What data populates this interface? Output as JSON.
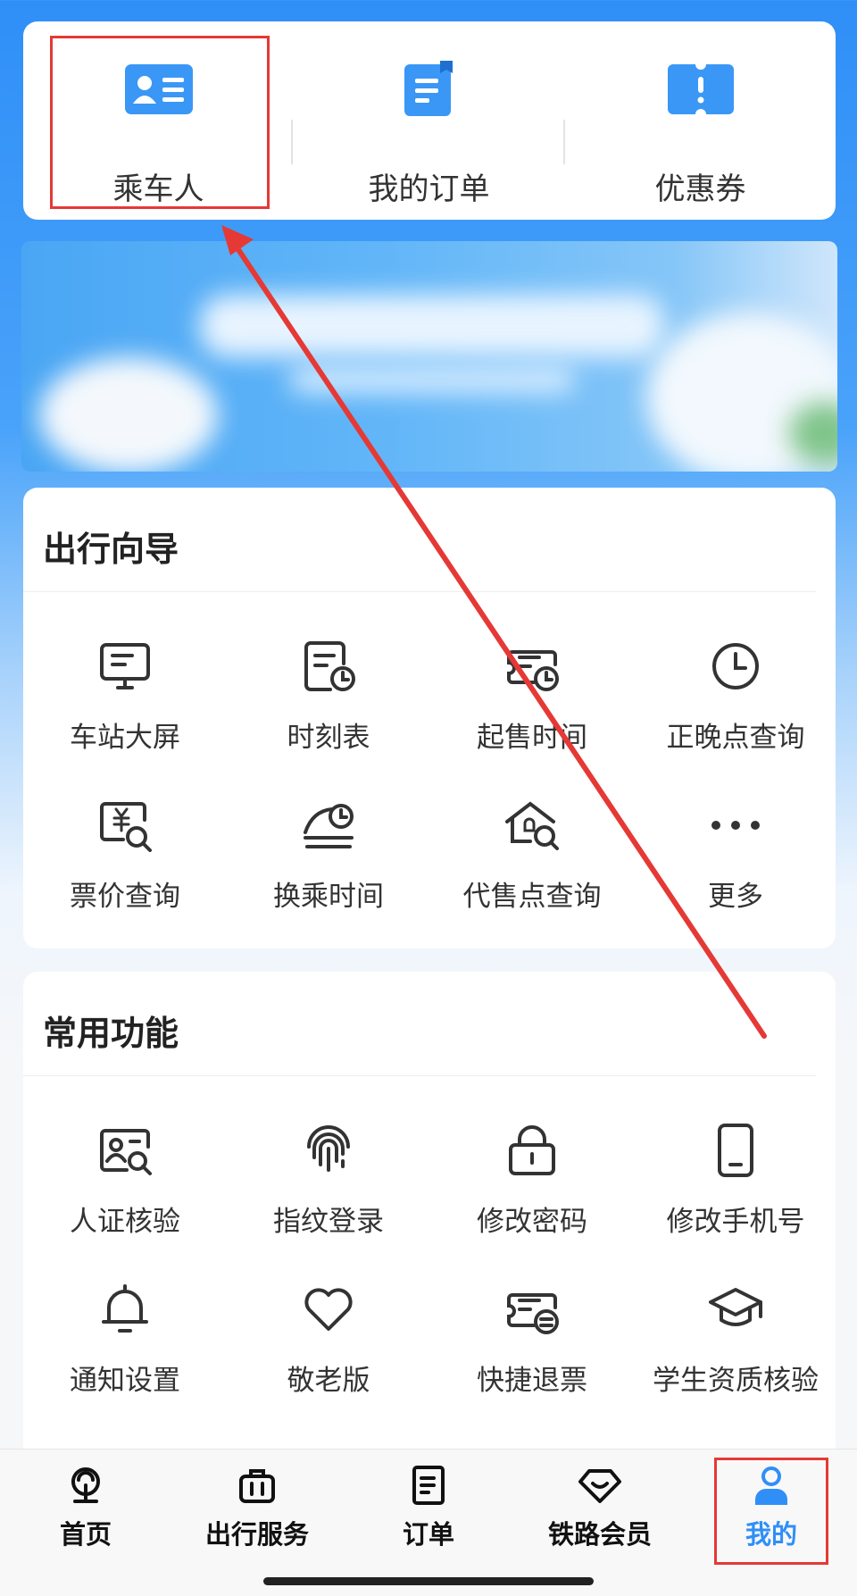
{
  "quick": {
    "items": [
      {
        "label": "乘车人",
        "icon": "passenger-card-icon"
      },
      {
        "label": "我的订单",
        "icon": "order-document-icon"
      },
      {
        "label": "优惠券",
        "icon": "coupon-icon"
      }
    ]
  },
  "travel_guide": {
    "title": "出行向导",
    "items": [
      {
        "label": "车站大屏",
        "icon": "monitor-icon"
      },
      {
        "label": "时刻表",
        "icon": "timetable-icon"
      },
      {
        "label": "起售时间",
        "icon": "ticket-clock-icon"
      },
      {
        "label": "正晚点查询",
        "icon": "clock-icon"
      },
      {
        "label": "票价查询",
        "icon": "fare-search-icon"
      },
      {
        "label": "换乘时间",
        "icon": "transfer-time-icon"
      },
      {
        "label": "代售点查询",
        "icon": "agency-search-icon"
      },
      {
        "label": "更多",
        "icon": "more-dots-icon"
      }
    ]
  },
  "common_functions": {
    "title": "常用功能",
    "items": [
      {
        "label": "人证核验",
        "icon": "id-verify-icon"
      },
      {
        "label": "指纹登录",
        "icon": "fingerprint-icon"
      },
      {
        "label": "修改密码",
        "icon": "lock-icon"
      },
      {
        "label": "修改手机号",
        "icon": "phone-icon"
      },
      {
        "label": "通知设置",
        "icon": "bell-icon"
      },
      {
        "label": "敬老版",
        "icon": "heart-icon"
      },
      {
        "label": "快捷退票",
        "icon": "refund-ticket-icon"
      },
      {
        "label": "学生资质核验",
        "icon": "graduation-cap-icon"
      }
    ]
  },
  "tabbar": {
    "items": [
      {
        "label": "首页",
        "icon": "railway-home-icon"
      },
      {
        "label": "出行服务",
        "icon": "luggage-icon"
      },
      {
        "label": "订单",
        "icon": "order-list-icon"
      },
      {
        "label": "铁路会员",
        "icon": "diamond-icon"
      },
      {
        "label": "我的",
        "icon": "user-profile-icon",
        "active": true
      }
    ]
  },
  "colors": {
    "accent": "#2f8ff7",
    "highlight": "#e53935",
    "icon_stroke": "#333333"
  }
}
